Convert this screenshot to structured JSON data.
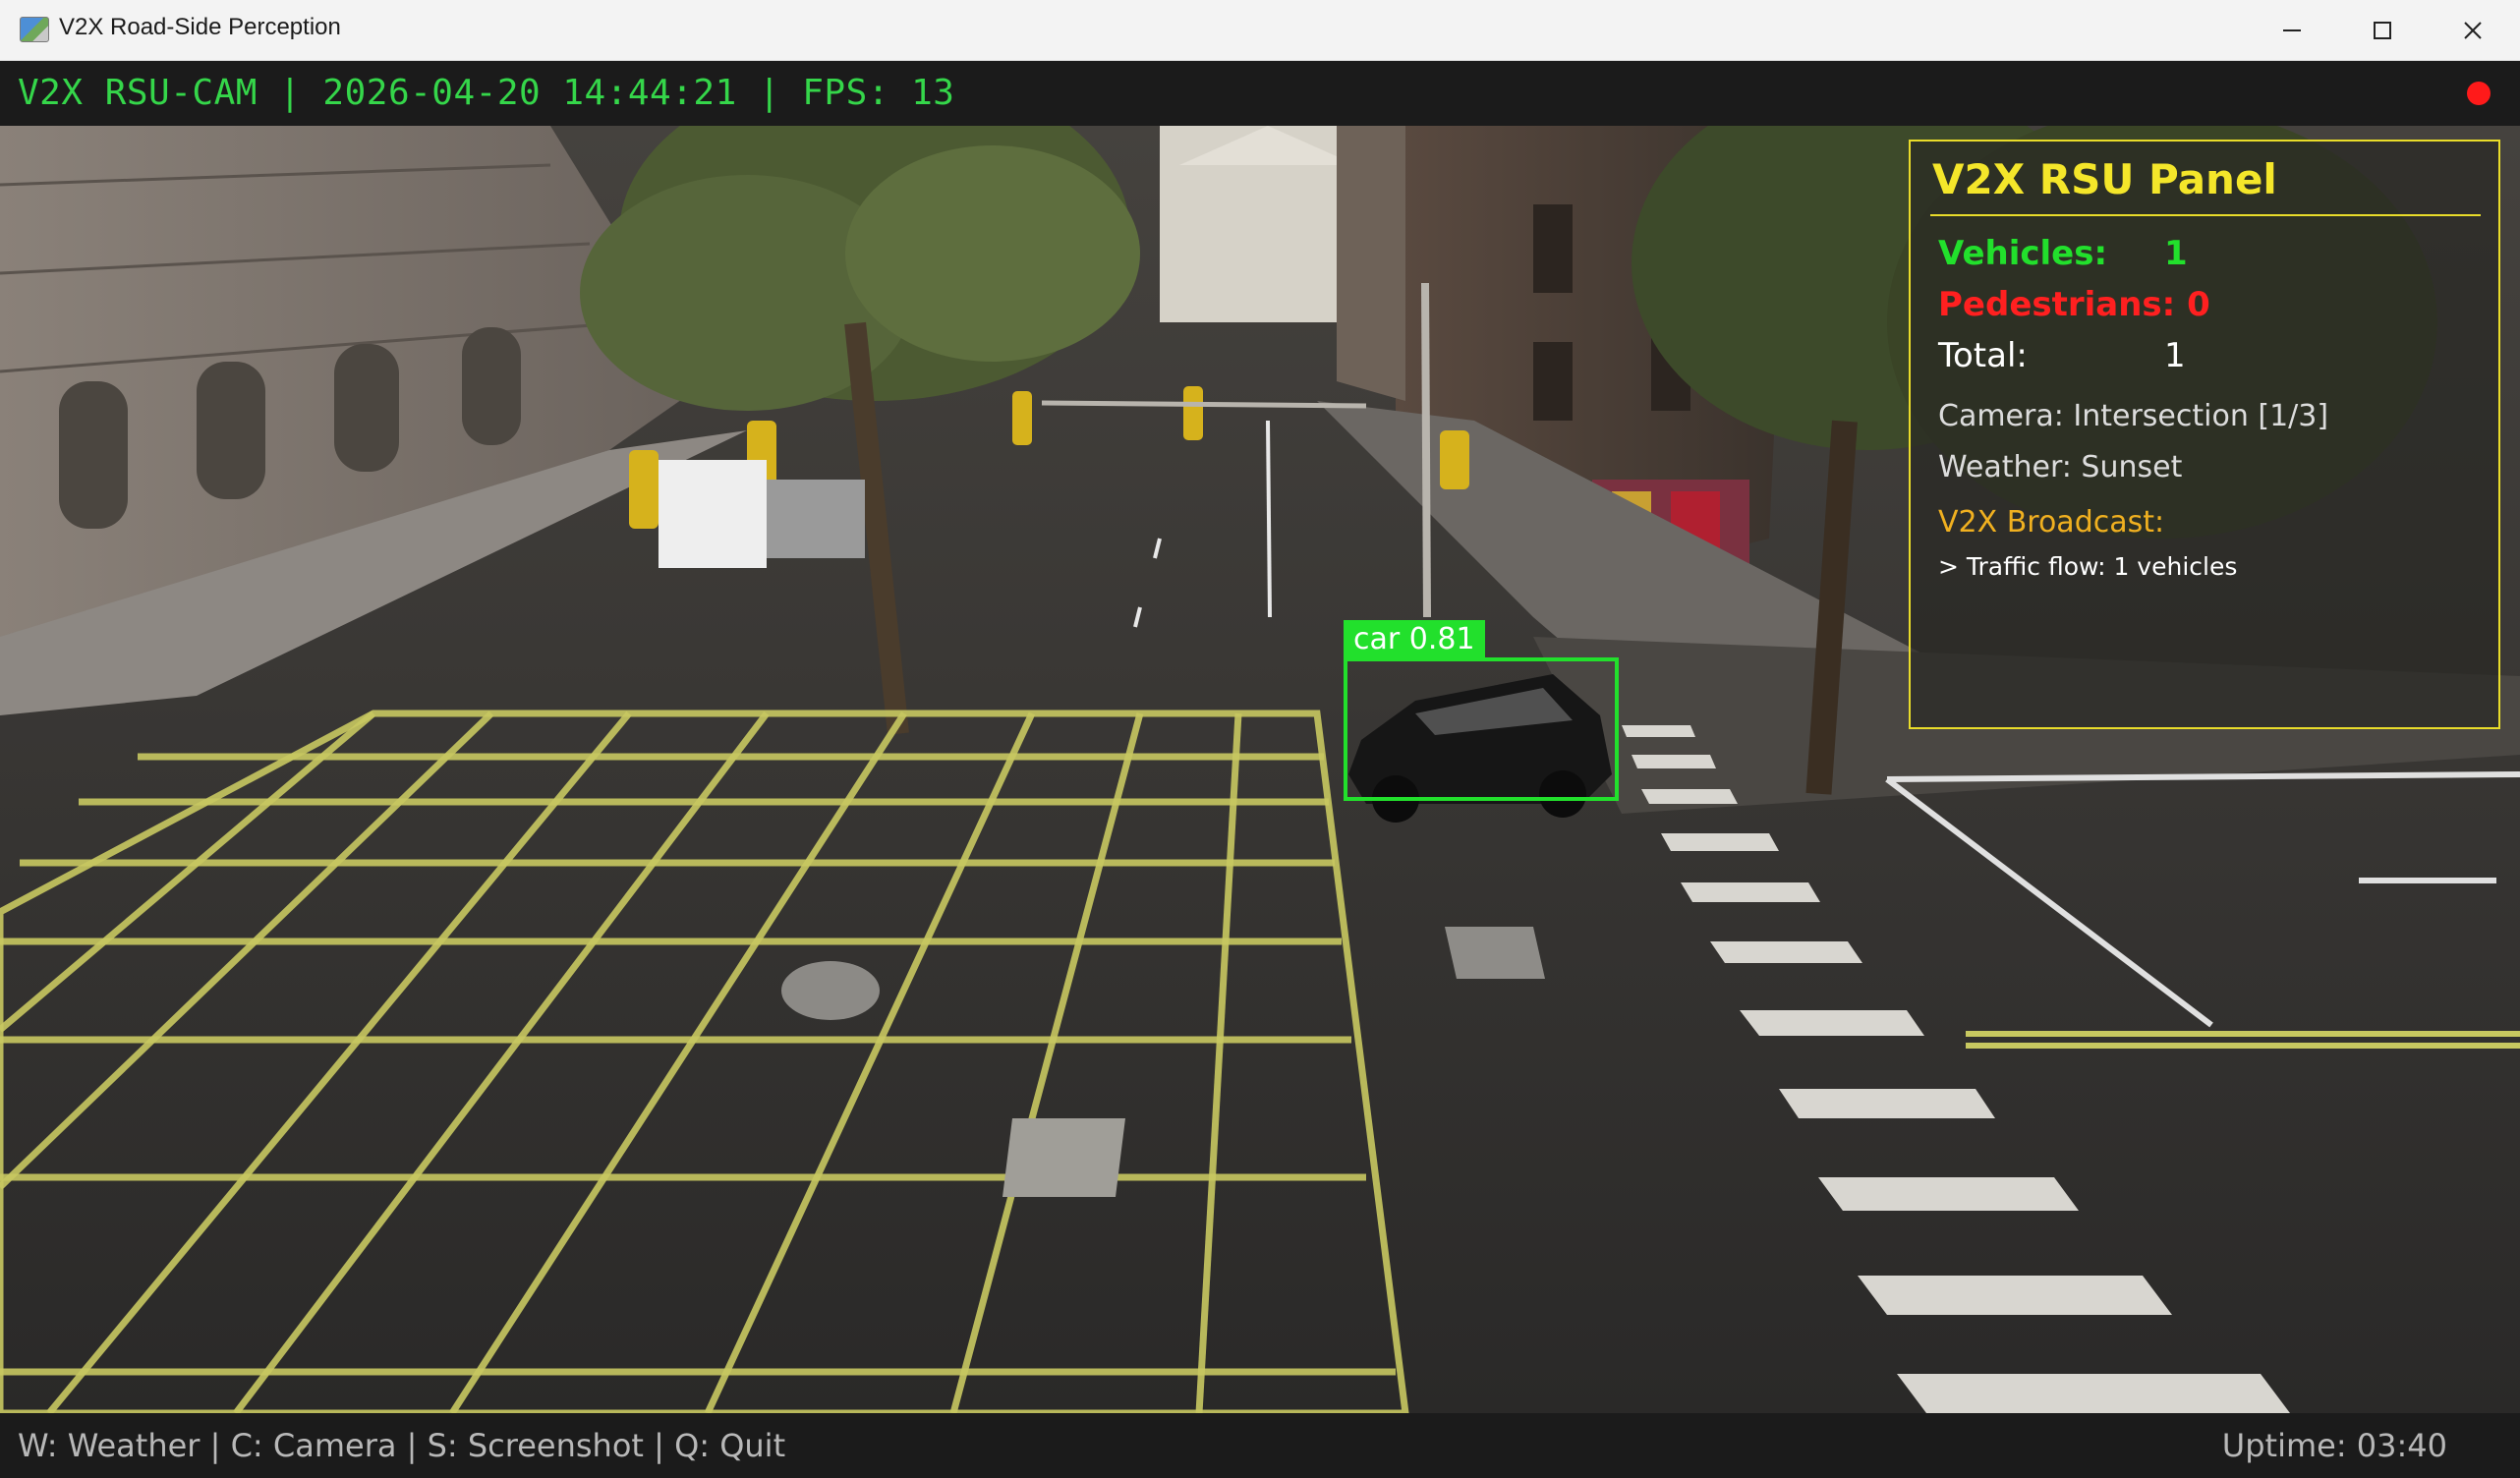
{
  "window": {
    "title": "V2X Road-Side Perception"
  },
  "hud_top": {
    "text": "V2X RSU-CAM | 2026-04-20 14:44:21 | FPS: 13"
  },
  "panel": {
    "title": "V2X RSU Panel",
    "vehicles_label": "Vehicles:",
    "vehicles_value": "1",
    "pedestrians_label": "Pedestrians:",
    "pedestrians_value": "0",
    "total_label": "Total:",
    "total_value": "1",
    "camera": "Camera: Intersection [1/3]",
    "weather": "Weather: Sunset",
    "broadcast_label": "V2X Broadcast:",
    "broadcast_msg": "> Traffic flow: 1 vehicles"
  },
  "detection": {
    "label": "car 0.81"
  },
  "hud_bottom": {
    "shortcuts": "W: Weather | C: Camera | S: Screenshot | Q: Quit",
    "uptime": "Uptime: 03:40"
  },
  "colors": {
    "hud_green": "#35d64a",
    "panel_yellow": "#f4e62a",
    "pedestrian_red": "#ff2020",
    "vehicle_green": "#22e02c",
    "broadcast_orange": "#f0b020"
  }
}
